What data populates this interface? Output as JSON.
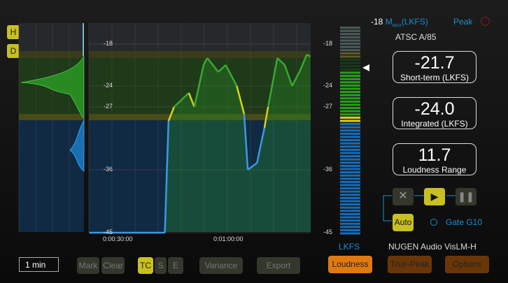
{
  "header": {
    "mmax_value": "-18",
    "mmax_label": "M",
    "mmax_sub": "MAX",
    "mmax_unit": "(LKFS)",
    "peak_label": "Peak",
    "standard": "ATSC A/85"
  },
  "readouts": [
    {
      "value": "-21.7",
      "label": "Short-term (LKFS)"
    },
    {
      "value": "-24.0",
      "label": "Integrated (LKFS)"
    },
    {
      "value": "11.7",
      "label": "Loudness Range"
    }
  ],
  "side_buttons": {
    "h": "H",
    "d": "D"
  },
  "scale_ticks": [
    "-18",
    "-24",
    "-27",
    "-36",
    "-45"
  ],
  "time_ticks": [
    "0:00:30:00",
    "0:01:00:00"
  ],
  "meter_unit": "LKFS",
  "brand": "NUGEN Audio VisLM-H",
  "toolbar": {
    "timescale": "1 min",
    "mark": "Mark",
    "clear": "Clear",
    "tc": "TC",
    "s": "S",
    "e": "E",
    "variance": "Variance",
    "export": "Export"
  },
  "tabs": [
    "Loudness",
    "True-Peak",
    "Options"
  ],
  "transport": {
    "auto": "Auto",
    "gate": "Gate G10"
  },
  "colors": {
    "accent": "#c8c020",
    "blue": "#1a8fd0",
    "green": "#3aa830",
    "tab_active": "#e07a10"
  },
  "chart_data": {
    "type": "line",
    "ylim": [
      -45,
      -15
    ],
    "yticks": [
      -18,
      -24,
      -27,
      -36,
      -45
    ],
    "xticks": [
      "0:00:30:00",
      "0:01:00:00"
    ],
    "short_term": [
      [
        21,
        -45
      ],
      [
        41.5,
        -45
      ],
      [
        42.5,
        -29
      ],
      [
        44,
        -27
      ],
      [
        48,
        -25
      ],
      [
        49.5,
        -27
      ],
      [
        52,
        -21
      ],
      [
        53,
        -20
      ],
      [
        56,
        -22
      ],
      [
        58,
        -21
      ],
      [
        61,
        -24
      ],
      [
        63,
        -28
      ],
      [
        64,
        -36
      ],
      [
        66.5,
        -35
      ],
      [
        68.5,
        -30
      ],
      [
        69.5,
        -27
      ],
      [
        72,
        -20
      ],
      [
        74,
        -21
      ],
      [
        76,
        -24
      ],
      [
        78,
        -22
      ],
      [
        80,
        -19.5
      ],
      [
        81,
        -19.8
      ]
    ],
    "target_band": [
      -20,
      -28
    ],
    "meter_level": -21.7
  }
}
